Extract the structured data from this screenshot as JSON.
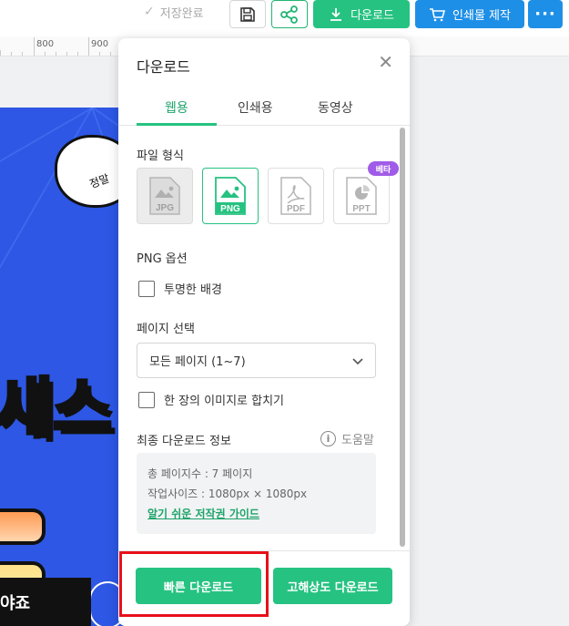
{
  "toolbar": {
    "saved_label": "저장완료",
    "download_label": "다운로드",
    "print_label": "인쇄물 제작",
    "more_label": "···",
    "accent_green": "#26c281",
    "accent_blue": "#1e8fe6"
  },
  "ruler": {
    "labels": [
      "800",
      "900"
    ]
  },
  "canvas": {
    "bubble_text": "정말",
    "big_text": "새스",
    "bottom_text": "야죠"
  },
  "panel": {
    "title": "다운로드",
    "tabs": [
      {
        "label": "웹용",
        "active": true
      },
      {
        "label": "인쇄용",
        "active": false
      },
      {
        "label": "동영상",
        "active": false
      }
    ],
    "file_format_label": "파일 형식",
    "formats": [
      {
        "label": "JPG",
        "state": "disabled",
        "icon": "jpg-file-icon"
      },
      {
        "label": "PNG",
        "state": "selected",
        "icon": "png-file-icon"
      },
      {
        "label": "PDF",
        "state": "normal",
        "icon": "pdf-file-icon"
      },
      {
        "label": "PPT",
        "state": "normal",
        "icon": "ppt-file-icon"
      }
    ],
    "beta_badge": "베타",
    "png_options_label": "PNG 옵션",
    "transparent_bg_label": "투명한 배경",
    "page_select_label": "페이지 선택",
    "page_select_value": "모든 페이지 (1~7)",
    "merge_label": "한 장의 이미지로 합치기",
    "final_info_label": "최종 다운로드 정보",
    "help_label": "도움말",
    "info_pages": "총 페이지수 : 7 페이지",
    "info_size": "작업사이즈 : 1080px × 1080px",
    "info_link": "알기 쉬운 저작권 가이드",
    "fast_download_label": "빠른 다운로드",
    "hires_download_label": "고해상도 다운로드"
  }
}
